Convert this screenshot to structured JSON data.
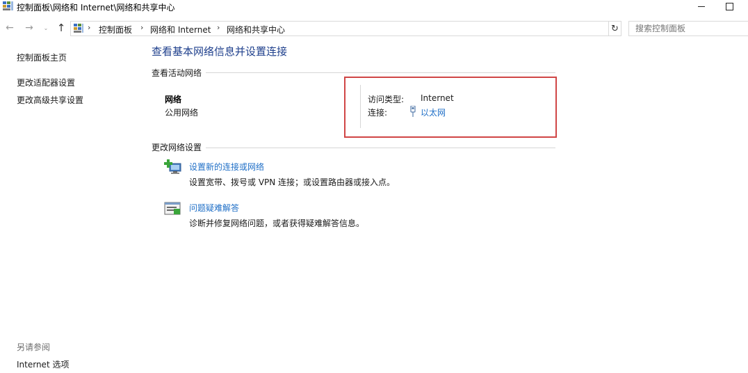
{
  "window": {
    "title": "控制面板\\网络和 Internet\\网络和共享中心"
  },
  "navigation": {
    "breadcrumbs": [
      "控制面板",
      "网络和 Internet",
      "网络和共享中心"
    ],
    "search_placeholder": "搜索控制面板"
  },
  "sidebar": {
    "links": [
      "控制面板主页",
      "更改适配器设置",
      "更改高级共享设置"
    ],
    "see_also_heading": "另请参阅",
    "see_also_links": [
      "Internet 选项"
    ]
  },
  "main": {
    "title": "查看基本网络信息并设置连接",
    "active_networks": {
      "heading": "查看活动网络",
      "network_name": "网络",
      "network_type": "公用网络",
      "access_type_label": "访问类型:",
      "access_type_value": "Internet",
      "connections_label": "连接:",
      "connection_link": "以太网"
    },
    "change_settings": {
      "heading": "更改网络设置",
      "tasks": [
        {
          "link": "设置新的连接或网络",
          "description": "设置宽带、拨号或 VPN 连接；或设置路由器或接入点。",
          "icon": "new-connection-icon"
        },
        {
          "link": "问题疑难解答",
          "description": "诊断并修复网络问题，或者获得疑难解答信息。",
          "icon": "troubleshoot-icon"
        }
      ]
    }
  },
  "colors": {
    "title_blue": "#1e3f8c",
    "link_blue": "#1f6fc7",
    "highlight_red": "#d04545"
  }
}
